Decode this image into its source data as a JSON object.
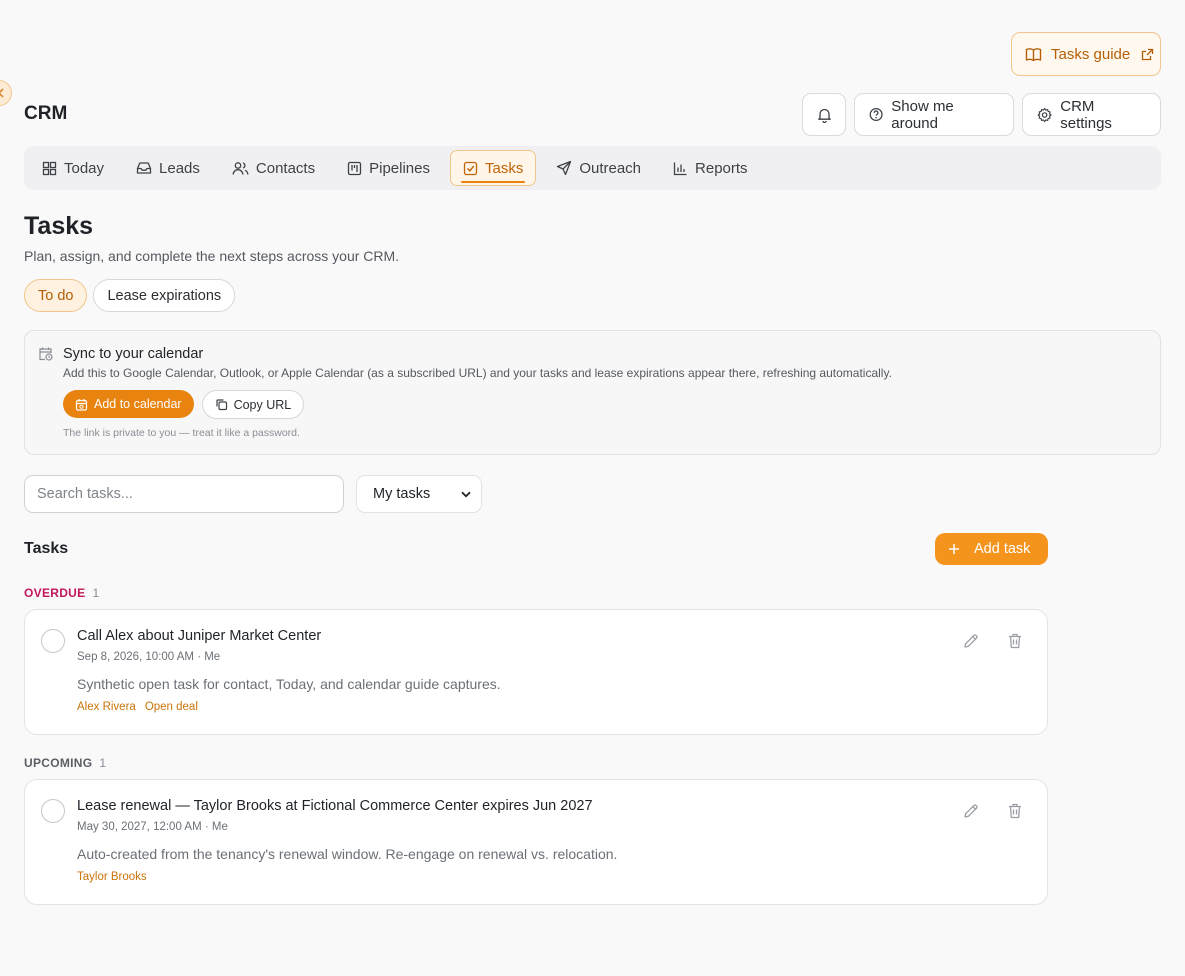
{
  "header": {
    "guide_label": "Tasks guide",
    "app_title": "CRM",
    "show_me_around": "Show me around",
    "crm_settings": "CRM settings"
  },
  "nav": {
    "items": [
      {
        "label": "Today",
        "icon": "grid-icon"
      },
      {
        "label": "Leads",
        "icon": "inbox-icon"
      },
      {
        "label": "Contacts",
        "icon": "users-icon"
      },
      {
        "label": "Pipelines",
        "icon": "kanban-icon"
      },
      {
        "label": "Tasks",
        "icon": "check-square-icon",
        "active": true
      },
      {
        "label": "Outreach",
        "icon": "send-icon"
      },
      {
        "label": "Reports",
        "icon": "bar-chart-icon"
      }
    ]
  },
  "page": {
    "title": "Tasks",
    "subtitle": "Plan, assign, and complete the next steps across your CRM.",
    "tabs": [
      "To do",
      "Lease expirations"
    ]
  },
  "sync": {
    "title": "Sync to your calendar",
    "description": "Add this to Google Calendar, Outlook, or Apple Calendar (as a subscribed URL) and your tasks and lease expirations appear there, refreshing automatically.",
    "add_label": "Add to calendar",
    "copy_label": "Copy URL",
    "note": "The link is private to you — treat it like a password."
  },
  "filters": {
    "search_placeholder": "Search tasks...",
    "scope_selected": "My tasks"
  },
  "tasks": {
    "section_title": "Tasks",
    "add_label": "Add task",
    "groups": [
      {
        "label": "OVERDUE",
        "count": "1",
        "items": [
          {
            "title": "Call Alex about Juniper Market Center",
            "meta": "Sep 8, 2026, 10:00 AM · Me",
            "description": "Synthetic open task for contact, Today, and calendar guide captures.",
            "links": [
              "Alex Rivera",
              "Open deal"
            ]
          }
        ]
      },
      {
        "label": "UPCOMING",
        "count": "1",
        "items": [
          {
            "title": "Lease renewal — Taylor Brooks at Fictional Commerce Center expires Jun 2027",
            "meta": "May 30, 2027, 12:00 AM · Me",
            "description": "Auto-created from the tenancy's renewal window. Re-engage on renewal vs. relocation.",
            "links": [
              "Taylor Brooks"
            ]
          }
        ]
      }
    ]
  },
  "colors": {
    "accent": "#e8830f",
    "accent_text": "#b45f06",
    "overdue": "#c2185b"
  }
}
